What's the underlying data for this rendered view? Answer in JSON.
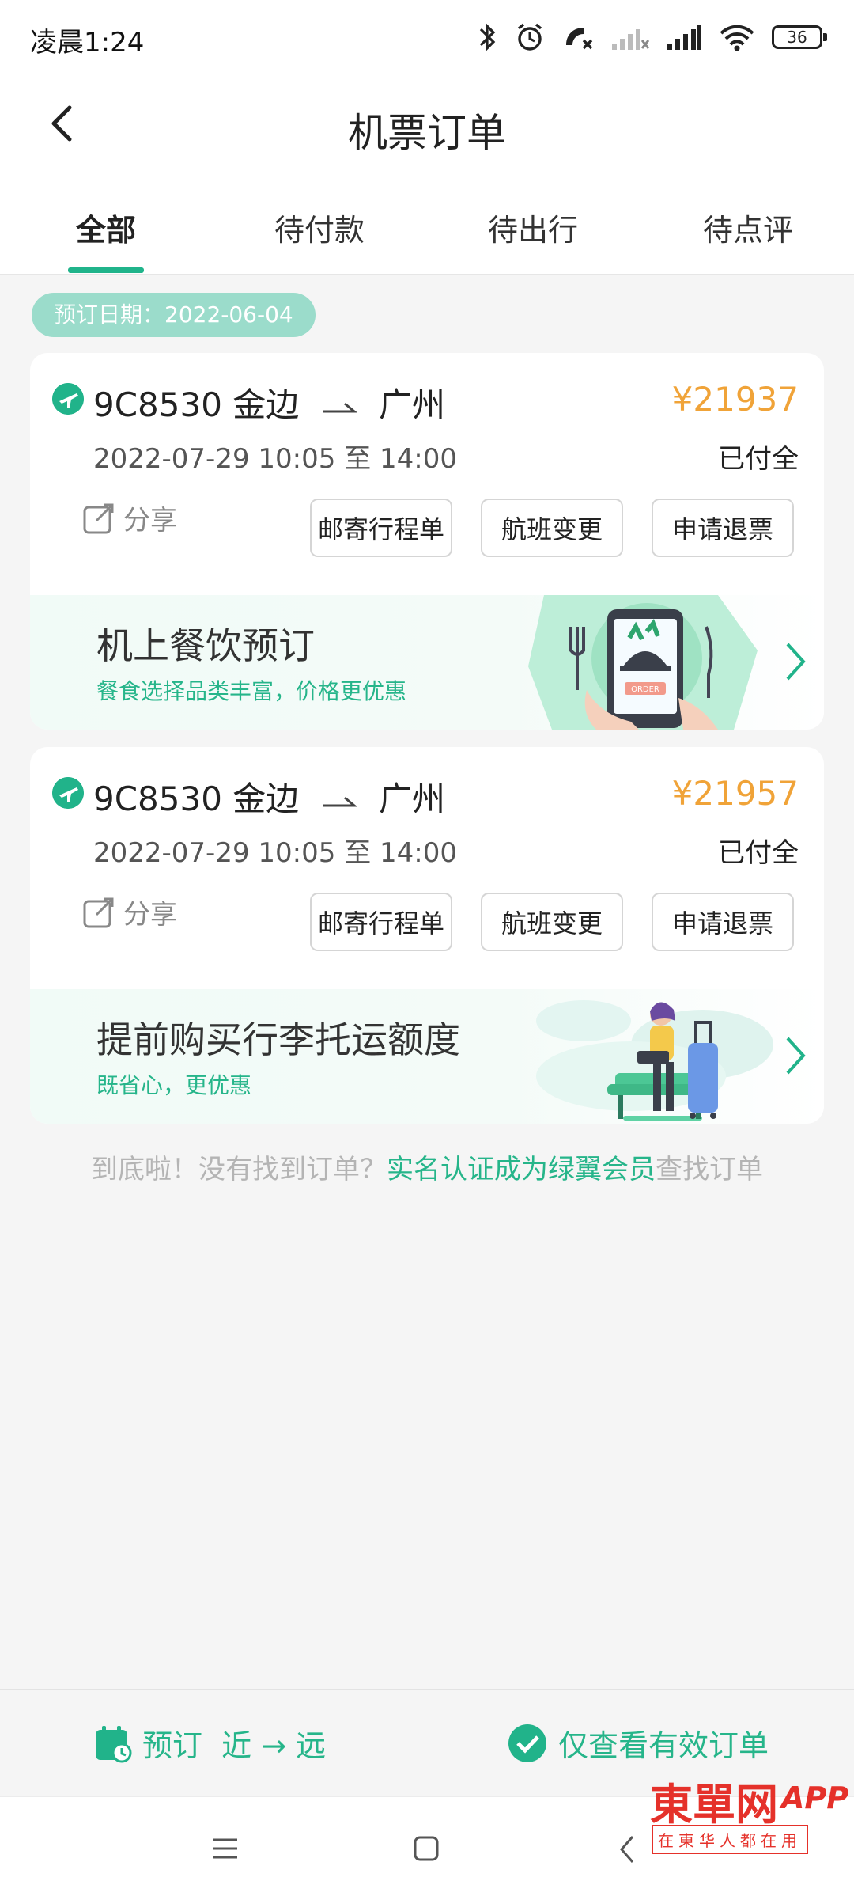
{
  "status_bar": {
    "time": "凌晨1:24",
    "battery": "36"
  },
  "header": {
    "title": "机票订单"
  },
  "tabs": [
    {
      "label": "全部",
      "active": true
    },
    {
      "label": "待付款"
    },
    {
      "label": "待出行"
    },
    {
      "label": "待点评"
    }
  ],
  "date_group": {
    "label": "预订日期：2022-06-04"
  },
  "orders": [
    {
      "flight_no": "9C8530",
      "from": "金边",
      "to": "广州",
      "price": "¥21937",
      "datetime": "2022-07-29 10:05 至 14:00",
      "status": "已付全",
      "share_label": "分享",
      "buttons": [
        "邮寄行程单",
        "航班变更",
        "申请退票"
      ],
      "promo": {
        "title": "机上餐饮预订",
        "subtitle": "餐食选择品类丰富，价格更优惠",
        "art_text": "ORDER"
      }
    },
    {
      "flight_no": "9C8530",
      "from": "金边",
      "to": "广州",
      "price": "¥21957",
      "datetime": "2022-07-29 10:05 至 14:00",
      "status": "已付全",
      "share_label": "分享",
      "buttons": [
        "邮寄行程单",
        "航班变更",
        "申请退票"
      ],
      "promo": {
        "title": "提前购买行李托运额度",
        "subtitle": "既省心，更优惠"
      }
    }
  ],
  "footer_note": {
    "prefix": "到底啦！没有找到订单？",
    "link": "实名认证成为绿翼会员",
    "suffix": "查找订单"
  },
  "bottom_bar": {
    "sort_label": "预订  近 → 远",
    "filter_label": "仅查看有效订单"
  },
  "watermark": {
    "main": "東單网",
    "app": "APP",
    "sub": "在東华人都在用"
  },
  "colors": {
    "accent": "#21b38a",
    "price": "#f0a338"
  }
}
